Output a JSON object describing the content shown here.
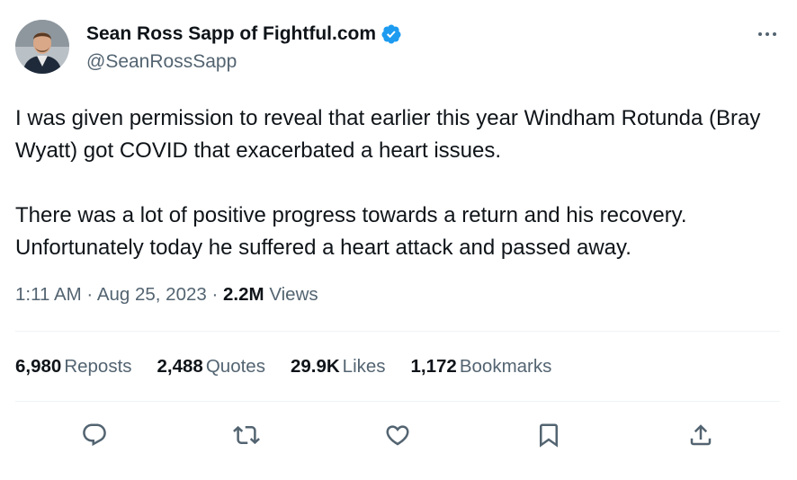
{
  "author": {
    "display_name": "Sean Ross Sapp of Fightful.com",
    "handle": "@SeanRossSapp",
    "verified": true,
    "verified_color": "#1d9bf0"
  },
  "tweet": {
    "paragraphs": [
      "I was given permission to reveal that earlier this year Windham Rotunda (Bray Wyatt) got COVID that exacerbated a heart issues.",
      "There was a lot of positive progress towards a return and his recovery. Unfortunately today he suffered a heart attack and passed away."
    ],
    "time": "1:11 AM",
    "sep1": "·",
    "date": "Aug 25, 2023",
    "sep2": "·",
    "views_count": "2.2M",
    "views_label": "Views"
  },
  "stats": {
    "reposts": {
      "count": "6,980",
      "label": "Reposts"
    },
    "quotes": {
      "count": "2,488",
      "label": "Quotes"
    },
    "likes": {
      "count": "29.9K",
      "label": "Likes"
    },
    "bookmarks": {
      "count": "1,172",
      "label": "Bookmarks"
    }
  },
  "actions": [
    "reply-icon",
    "repost-icon",
    "like-icon",
    "bookmark-icon",
    "share-icon"
  ],
  "colors": {
    "text": "#0f1419",
    "secondary": "#536471",
    "divider": "#eff3f4"
  }
}
